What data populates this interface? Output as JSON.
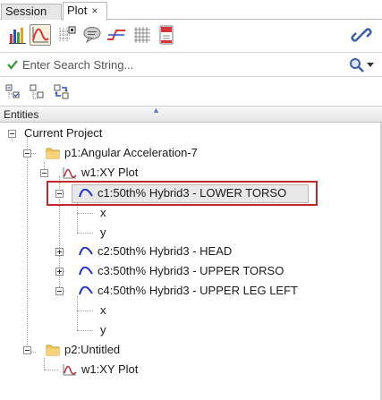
{
  "tabs": [
    {
      "label": "Session",
      "active": false
    },
    {
      "label": "Plot",
      "active": true,
      "close": "×"
    }
  ],
  "toolbar": {
    "icons": [
      "bar-chart-icon",
      "xy-curve-icon",
      "grid-select-icon",
      "comment-icon",
      "curve-filter-icon",
      "table-grid-icon",
      "document-red-icon"
    ],
    "selected": "xy-curve-icon",
    "right_icon": "link-icon"
  },
  "search": {
    "placeholder": "Enter Search String...",
    "status_icon": "checkmark-icon",
    "search_icon": "magnifier-icon"
  },
  "tree_tools": [
    "collapse-all-icon",
    "expand-all-icon",
    "sync-icon"
  ],
  "header": {
    "label": "Entities"
  },
  "tree": {
    "root": "Current Project",
    "p1": "p1:Angular Acceleration-7",
    "w1": "w1:XY Plot",
    "c1": "c1:50th% Hybrid3   - LOWER TORSO",
    "c1_x": "x",
    "c1_y": "y",
    "c2": "c2:50th% Hybrid3   - HEAD",
    "c3": "c3:50th% Hybrid3   - UPPER TORSO",
    "c4": "c4:50th% Hybrid3   - UPPER LEG LEFT",
    "c4_x": "x",
    "c4_y": "y",
    "p2": "p2:Untitled",
    "p2_w1": "w1:XY Plot"
  },
  "colors": {
    "highlight": "#c0272d",
    "curve_blue": "#1f2fd0",
    "plot_red": "#c0272d",
    "folder": "#e8b84a",
    "check_green": "#2e9e2e"
  }
}
